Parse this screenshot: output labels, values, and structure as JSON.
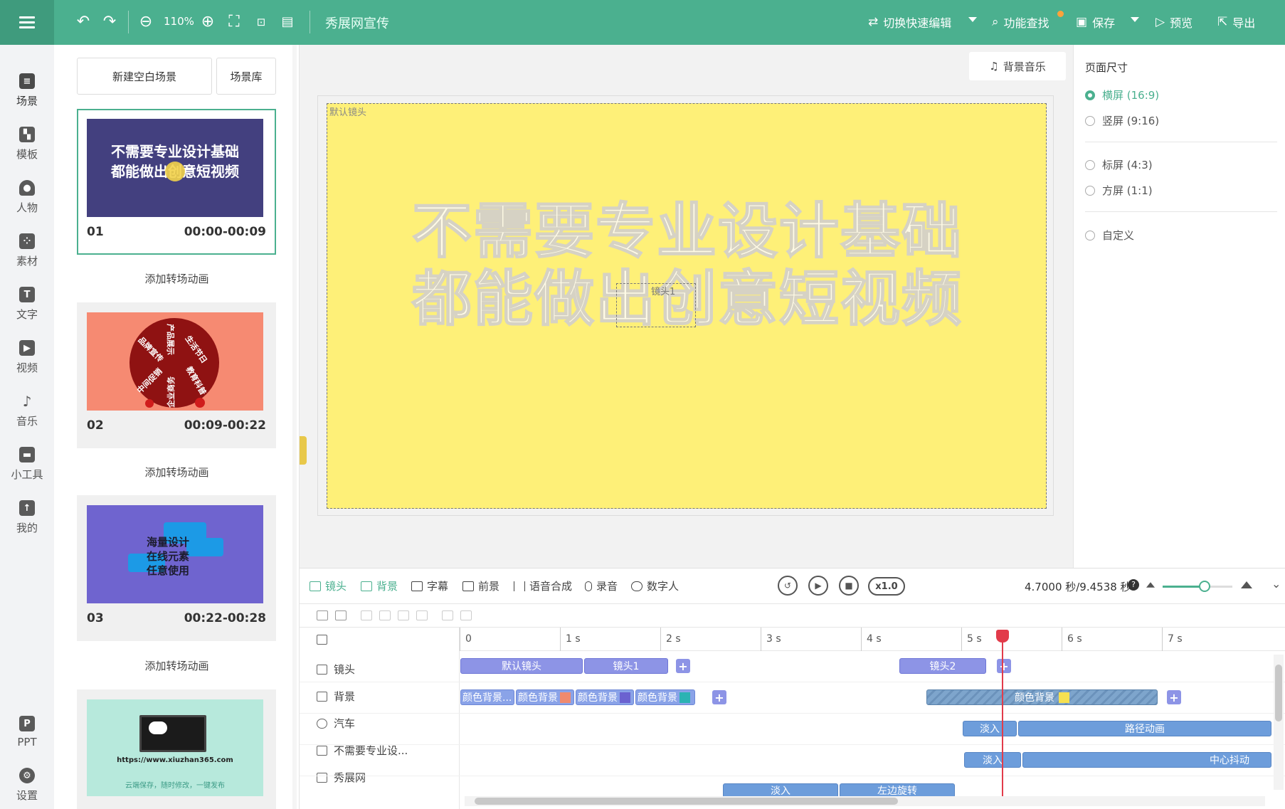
{
  "topbar": {
    "zoom": "110%",
    "doc_title": "秀展网宣传",
    "quick_edit": "切换快速编辑",
    "feature_search": "功能查找",
    "save": "保存",
    "preview": "预览",
    "export": "导出",
    "colors": {
      "bar": "#4bb08f",
      "menu": "#3f9b7d",
      "badge": "#ffa23a"
    }
  },
  "leftnav": {
    "items": [
      "场景",
      "模板",
      "人物",
      "素材",
      "文字",
      "视频",
      "音乐",
      "小工具",
      "我的"
    ],
    "bottom_items": [
      "PPT",
      "设置"
    ]
  },
  "scenes": {
    "new_blank": "新建空白场景",
    "library": "场景库",
    "add_transition": "添加转场动画",
    "list": [
      {
        "num": "01",
        "time": "00:00-00:09",
        "line1": "不需要专业设计基础",
        "line2": "都能做出创意短视频"
      },
      {
        "num": "02",
        "time": "00:09-00:22",
        "labels": [
          "品牌宣传",
          "生活节日",
          "中间促销",
          "教育科普",
          "企业商务",
          "产品展示"
        ]
      },
      {
        "num": "03",
        "time": "00:22-00:28",
        "labels": [
          "海量设计",
          "在线元素",
          "任意使用"
        ]
      },
      {
        "num": "",
        "time": "",
        "labels": [
          "云端保存，随时修改，一键发布"
        ],
        "url": "https://www.xiuzhan365.com"
      }
    ]
  },
  "canvas": {
    "bgm": "背景音乐",
    "stage_label": "默认镜头",
    "line1": "不需要专业设计基础",
    "line2": "都能做出创意短视频",
    "lens_label": "镜头1",
    "stage_color": "#fef078"
  },
  "page_size": {
    "title": "页面尺寸",
    "options": [
      "横屏 (16:9)",
      "竖屏 (9:16)",
      "标屏 (4:3)",
      "方屏 (1:1)",
      "自定义"
    ],
    "selected": "横屏 (16:9)"
  },
  "timeline": {
    "tabs": [
      "镜头",
      "背景",
      "字幕",
      "前景",
      "语音合成",
      "录音",
      "数字人"
    ],
    "selected_tab": "背景",
    "speed": "x1.0",
    "time_readout": "4.7000 秒/9.4538 秒",
    "zoom_level": 0.6,
    "ruler": [
      "0",
      "1 s",
      "2 s",
      "3 s",
      "4 s",
      "5 s",
      "6 s",
      "7 s"
    ],
    "tracks": [
      "镜头",
      "背景",
      "汽车",
      "不需要专业设...",
      "秀展网"
    ],
    "lens_clips": [
      "默认镜头",
      "镜头1",
      "镜头2"
    ],
    "bg_clips": [
      "颜色背景...",
      "颜色背景",
      "颜色背景",
      "颜色背景",
      "颜色背景"
    ],
    "car_clips": [
      "淡入",
      "路径动画"
    ],
    "text_clips": [
      "淡入",
      "中心抖动"
    ],
    "brand_clips": [
      "淡入",
      "左边旋转"
    ],
    "swatches": [
      "#f08a6e",
      "#6b62d0",
      "#2bb3b3",
      "#f5e050"
    ],
    "playhead_color": "#e23b4a"
  }
}
